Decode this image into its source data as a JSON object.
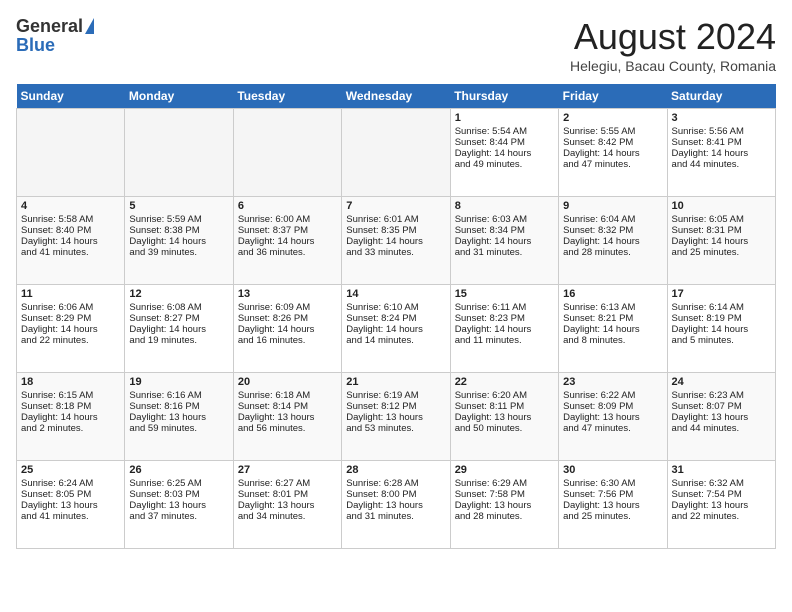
{
  "header": {
    "logo_line1": "General",
    "logo_line2": "Blue",
    "title": "August 2024",
    "subtitle": "Helegiu, Bacau County, Romania"
  },
  "weekdays": [
    "Sunday",
    "Monday",
    "Tuesday",
    "Wednesday",
    "Thursday",
    "Friday",
    "Saturday"
  ],
  "weeks": [
    [
      {
        "day": "",
        "empty": true
      },
      {
        "day": "",
        "empty": true
      },
      {
        "day": "",
        "empty": true
      },
      {
        "day": "",
        "empty": true
      },
      {
        "day": "1",
        "lines": [
          "Sunrise: 5:54 AM",
          "Sunset: 8:44 PM",
          "Daylight: 14 hours",
          "and 49 minutes."
        ]
      },
      {
        "day": "2",
        "lines": [
          "Sunrise: 5:55 AM",
          "Sunset: 8:42 PM",
          "Daylight: 14 hours",
          "and 47 minutes."
        ]
      },
      {
        "day": "3",
        "lines": [
          "Sunrise: 5:56 AM",
          "Sunset: 8:41 PM",
          "Daylight: 14 hours",
          "and 44 minutes."
        ]
      }
    ],
    [
      {
        "day": "4",
        "lines": [
          "Sunrise: 5:58 AM",
          "Sunset: 8:40 PM",
          "Daylight: 14 hours",
          "and 41 minutes."
        ]
      },
      {
        "day": "5",
        "lines": [
          "Sunrise: 5:59 AM",
          "Sunset: 8:38 PM",
          "Daylight: 14 hours",
          "and 39 minutes."
        ]
      },
      {
        "day": "6",
        "lines": [
          "Sunrise: 6:00 AM",
          "Sunset: 8:37 PM",
          "Daylight: 14 hours",
          "and 36 minutes."
        ]
      },
      {
        "day": "7",
        "lines": [
          "Sunrise: 6:01 AM",
          "Sunset: 8:35 PM",
          "Daylight: 14 hours",
          "and 33 minutes."
        ]
      },
      {
        "day": "8",
        "lines": [
          "Sunrise: 6:03 AM",
          "Sunset: 8:34 PM",
          "Daylight: 14 hours",
          "and 31 minutes."
        ]
      },
      {
        "day": "9",
        "lines": [
          "Sunrise: 6:04 AM",
          "Sunset: 8:32 PM",
          "Daylight: 14 hours",
          "and 28 minutes."
        ]
      },
      {
        "day": "10",
        "lines": [
          "Sunrise: 6:05 AM",
          "Sunset: 8:31 PM",
          "Daylight: 14 hours",
          "and 25 minutes."
        ]
      }
    ],
    [
      {
        "day": "11",
        "lines": [
          "Sunrise: 6:06 AM",
          "Sunset: 8:29 PM",
          "Daylight: 14 hours",
          "and 22 minutes."
        ]
      },
      {
        "day": "12",
        "lines": [
          "Sunrise: 6:08 AM",
          "Sunset: 8:27 PM",
          "Daylight: 14 hours",
          "and 19 minutes."
        ]
      },
      {
        "day": "13",
        "lines": [
          "Sunrise: 6:09 AM",
          "Sunset: 8:26 PM",
          "Daylight: 14 hours",
          "and 16 minutes."
        ]
      },
      {
        "day": "14",
        "lines": [
          "Sunrise: 6:10 AM",
          "Sunset: 8:24 PM",
          "Daylight: 14 hours",
          "and 14 minutes."
        ]
      },
      {
        "day": "15",
        "lines": [
          "Sunrise: 6:11 AM",
          "Sunset: 8:23 PM",
          "Daylight: 14 hours",
          "and 11 minutes."
        ]
      },
      {
        "day": "16",
        "lines": [
          "Sunrise: 6:13 AM",
          "Sunset: 8:21 PM",
          "Daylight: 14 hours",
          "and 8 minutes."
        ]
      },
      {
        "day": "17",
        "lines": [
          "Sunrise: 6:14 AM",
          "Sunset: 8:19 PM",
          "Daylight: 14 hours",
          "and 5 minutes."
        ]
      }
    ],
    [
      {
        "day": "18",
        "lines": [
          "Sunrise: 6:15 AM",
          "Sunset: 8:18 PM",
          "Daylight: 14 hours",
          "and 2 minutes."
        ]
      },
      {
        "day": "19",
        "lines": [
          "Sunrise: 6:16 AM",
          "Sunset: 8:16 PM",
          "Daylight: 13 hours",
          "and 59 minutes."
        ]
      },
      {
        "day": "20",
        "lines": [
          "Sunrise: 6:18 AM",
          "Sunset: 8:14 PM",
          "Daylight: 13 hours",
          "and 56 minutes."
        ]
      },
      {
        "day": "21",
        "lines": [
          "Sunrise: 6:19 AM",
          "Sunset: 8:12 PM",
          "Daylight: 13 hours",
          "and 53 minutes."
        ]
      },
      {
        "day": "22",
        "lines": [
          "Sunrise: 6:20 AM",
          "Sunset: 8:11 PM",
          "Daylight: 13 hours",
          "and 50 minutes."
        ]
      },
      {
        "day": "23",
        "lines": [
          "Sunrise: 6:22 AM",
          "Sunset: 8:09 PM",
          "Daylight: 13 hours",
          "and 47 minutes."
        ]
      },
      {
        "day": "24",
        "lines": [
          "Sunrise: 6:23 AM",
          "Sunset: 8:07 PM",
          "Daylight: 13 hours",
          "and 44 minutes."
        ]
      }
    ],
    [
      {
        "day": "25",
        "lines": [
          "Sunrise: 6:24 AM",
          "Sunset: 8:05 PM",
          "Daylight: 13 hours",
          "and 41 minutes."
        ]
      },
      {
        "day": "26",
        "lines": [
          "Sunrise: 6:25 AM",
          "Sunset: 8:03 PM",
          "Daylight: 13 hours",
          "and 37 minutes."
        ]
      },
      {
        "day": "27",
        "lines": [
          "Sunrise: 6:27 AM",
          "Sunset: 8:01 PM",
          "Daylight: 13 hours",
          "and 34 minutes."
        ]
      },
      {
        "day": "28",
        "lines": [
          "Sunrise: 6:28 AM",
          "Sunset: 8:00 PM",
          "Daylight: 13 hours",
          "and 31 minutes."
        ]
      },
      {
        "day": "29",
        "lines": [
          "Sunrise: 6:29 AM",
          "Sunset: 7:58 PM",
          "Daylight: 13 hours",
          "and 28 minutes."
        ]
      },
      {
        "day": "30",
        "lines": [
          "Sunrise: 6:30 AM",
          "Sunset: 7:56 PM",
          "Daylight: 13 hours",
          "and 25 minutes."
        ]
      },
      {
        "day": "31",
        "lines": [
          "Sunrise: 6:32 AM",
          "Sunset: 7:54 PM",
          "Daylight: 13 hours",
          "and 22 minutes."
        ]
      }
    ]
  ]
}
